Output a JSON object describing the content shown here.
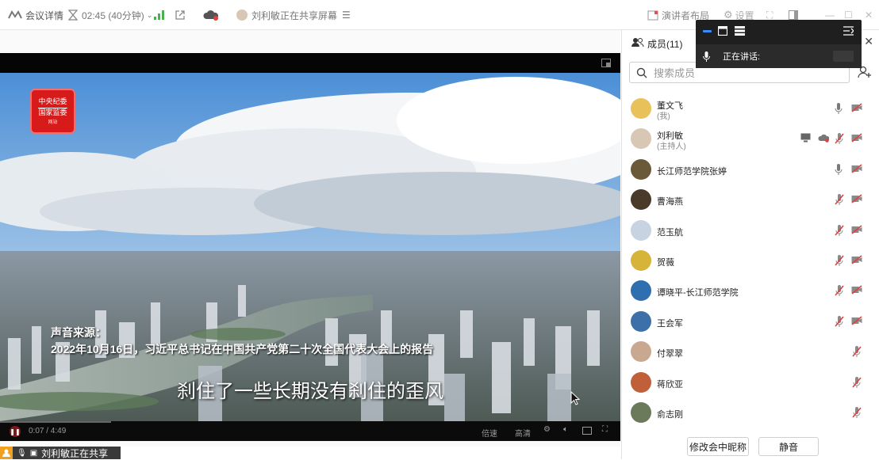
{
  "titlebar": {
    "meeting_details": "会议详情",
    "timer": "02:45 (40分钟)",
    "sharing_notice": "刘利敏正在共享屏幕",
    "layout_label": "演讲者布局",
    "settings_label": "设置"
  },
  "video": {
    "caption_source": "声音来源：",
    "caption_line": "2022年10月16日，习近平总书记在中国共产党第二十次全国代表大会上的报告",
    "subtitle": "刹住了一些长期没有刹住的歪风",
    "time": "0:07 / 4:49",
    "speed_label": "倍速",
    "quality_label": "高清",
    "logo_line1": "中央纪委",
    "logo_line2": "国家监委",
    "logo_line3": "网站"
  },
  "share_bar": {
    "text": "刘利敏正在共享"
  },
  "panel": {
    "members_title": "成员(11)",
    "search_placeholder": "搜索成员",
    "members": [
      {
        "name": "董文飞",
        "role": "(我)",
        "avatar_color": "#e8c15a",
        "mic": "on",
        "cam": "off"
      },
      {
        "name": "刘利敏",
        "role": "(主持人)",
        "avatar_color": "#d9c7b5",
        "mic": "muted",
        "cam": "off",
        "sharing": true
      },
      {
        "name": "长江师范学院张婷",
        "role": "",
        "avatar_color": "#6b5a3a",
        "mic": "on",
        "cam": "off"
      },
      {
        "name": "曹海燕",
        "role": "",
        "avatar_color": "#4a3a2a",
        "mic": "muted",
        "cam": "off"
      },
      {
        "name": "范玉航",
        "role": "",
        "avatar_color": "#c7d3e0",
        "mic": "muted",
        "cam": "off"
      },
      {
        "name": "贺薇",
        "role": "",
        "avatar_color": "#d6b43a",
        "mic": "muted",
        "cam": "off"
      },
      {
        "name": "谭晓平-长江师范学院",
        "role": "",
        "avatar_color": "#2f6fb0",
        "mic": "muted",
        "cam": "off"
      },
      {
        "name": "王会军",
        "role": "",
        "avatar_color": "#3d6fa8",
        "mic": "muted",
        "cam": "off"
      },
      {
        "name": "付翠翠",
        "role": "",
        "avatar_color": "#c8a890",
        "mic": "muted",
        "cam": "none"
      },
      {
        "name": "蒋欣亚",
        "role": "",
        "avatar_color": "#c0603a",
        "mic": "muted",
        "cam": "none"
      },
      {
        "name": "俞志刚",
        "role": "",
        "avatar_color": "#6a7a5a",
        "mic": "muted",
        "cam": "none"
      }
    ],
    "rename_button": "修改会中昵称",
    "mute_button": "静音"
  },
  "speaking": {
    "label": "正在讲话:"
  },
  "colors": {
    "accent": "#1e6fff",
    "muted_red": "#e04040",
    "panel_border": "#e2e2e2"
  }
}
